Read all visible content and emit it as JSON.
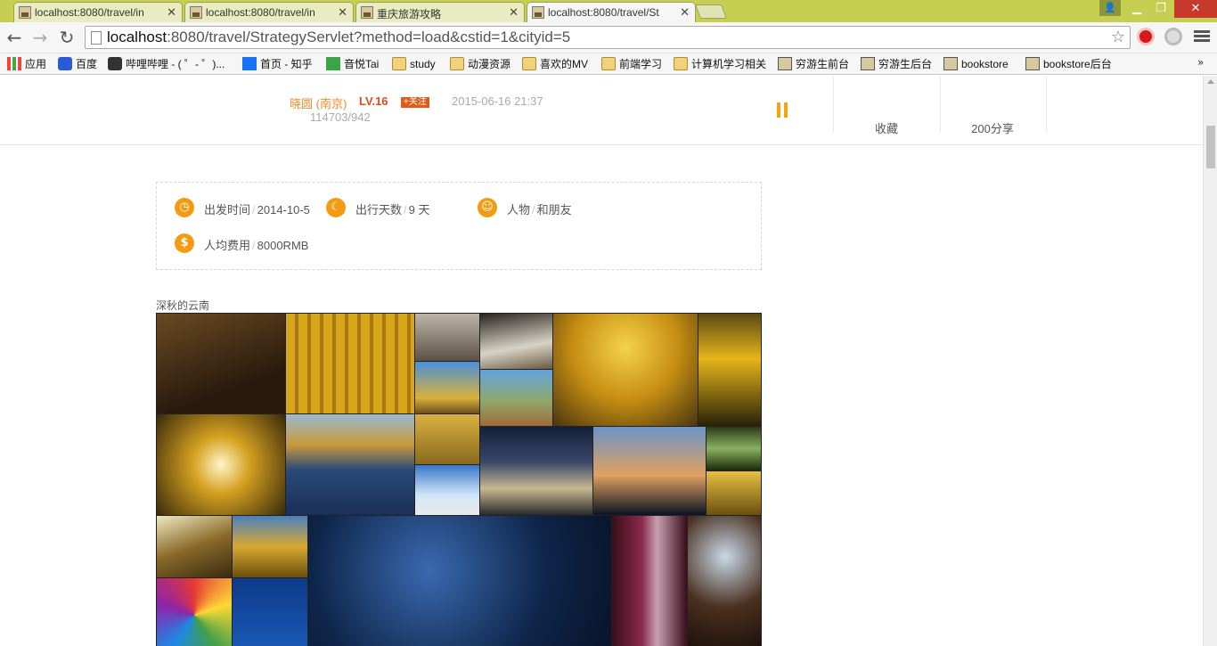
{
  "browser": {
    "tabs": [
      {
        "title": "localhost:8080/travel/in",
        "active": false
      },
      {
        "title": "localhost:8080/travel/in",
        "active": false
      },
      {
        "title": "重庆旅游攻略",
        "active": false
      },
      {
        "title": "localhost:8080/travel/St",
        "active": true
      }
    ],
    "url_host": "localhost",
    "url_rest": ":8080/travel/StrategyServlet?method=load&cstid=1&cityid=5",
    "bookmarks": [
      "应用",
      "百度",
      "哔哩哔哩 - ( ゜- ゜)...",
      "首页 - 知乎",
      "音悦Tai",
      "study",
      "动漫资源",
      "喜欢的MV",
      "前端学习",
      "计算机学习相关",
      "穷游生前台",
      "穷游生后台",
      "bookstore",
      "bookstore后台"
    ]
  },
  "author": {
    "name": "晓圆 (南京)",
    "level": "LV.16",
    "follow_label": "+关注",
    "date": "2015-06-16 21:37",
    "stats": "114703/942"
  },
  "actions": {
    "favorite": "收藏",
    "share": "200分享"
  },
  "trip": {
    "depart_label": "出发时间",
    "depart_value": "2014-10-5",
    "days_label": "出行天数",
    "days_value": "9 天",
    "people_label": "人物",
    "people_value": "和朋友",
    "cost_label": "人均费用",
    "cost_value": "8000RMB",
    "separator": "/"
  },
  "gallery": {
    "caption": "深秋的云南"
  },
  "colors": {
    "accent_orange": "#f39b12",
    "author_orange": "#f08a28",
    "level_red": "#e04b1d"
  }
}
